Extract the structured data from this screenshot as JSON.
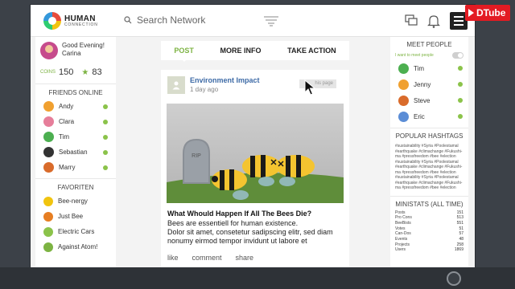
{
  "header": {
    "logo_line1": "HUMAN",
    "logo_line2": "CONNECTION",
    "search_placeholder": "Search Network"
  },
  "overlay": {
    "brand": "DTube"
  },
  "user": {
    "greeting": "Good Evening!",
    "name": "Carina",
    "coins_label": "COINS",
    "coins": "150",
    "stars": "83"
  },
  "friends": {
    "title": "FRIENDS ONLINE",
    "items": [
      {
        "name": "Andy",
        "color": "#f0a030"
      },
      {
        "name": "Clara",
        "color": "#e67e9a"
      },
      {
        "name": "Tim",
        "color": "#4caf50"
      },
      {
        "name": "Sebastian",
        "color": "#333333"
      },
      {
        "name": "Marry",
        "color": "#d96b2b"
      }
    ]
  },
  "favorites": {
    "title": "FAVORITEN",
    "items": [
      {
        "name": "Bee-nergy",
        "color": "#f1c40f"
      },
      {
        "name": "Just Bee",
        "color": "#e67e22"
      },
      {
        "name": "Electric Cars",
        "color": "#8bc34a"
      },
      {
        "name": "Against Atom!",
        "color": "#7cb342"
      }
    ]
  },
  "tabs": [
    {
      "label": "POST",
      "active": true
    },
    {
      "label": "MORE INFO",
      "active": false
    },
    {
      "label": "TAKE ACTION",
      "active": false
    }
  ],
  "post": {
    "author": "Environment Impact",
    "time": "1 day ago",
    "page_chip": "his page",
    "image_text": "RIP",
    "headline": "What Whould Happen If All The Bees Die?",
    "body_line1": "Bees are essentiell for human existence.",
    "body_line2": "Dolor sit amet, consetetur sadipscing elitr, sed diam",
    "body_line3": "nonumy eirmod tempor invidunt ut labore et",
    "actions": [
      "like",
      "comment",
      "share"
    ]
  },
  "meet_people": {
    "title": "MEET PEOPLE",
    "toggle_label": "I want to meet people",
    "items": [
      {
        "name": "Tim",
        "color": "#4caf50"
      },
      {
        "name": "Jenny",
        "color": "#f0a030"
      },
      {
        "name": "Steve",
        "color": "#d96b2b"
      },
      {
        "name": "Eric",
        "color": "#5b8dd6"
      }
    ]
  },
  "hashtags": {
    "title": "POPULAR HASHTAGS",
    "lines": [
      "#sustainability #Syria #Poolestamal",
      "#earthquake #climachange #Fukushi-",
      "ma #pressfreedom #bee #election",
      "#sustainability #Syria #Poolestamal",
      "#earthquake #climachange #Fukushi-",
      "ma #pressfreedom #bee #election",
      "#sustainability #Syria #Poolestamal",
      "#earthquake #climachange #Fukushi-",
      "ma #pressfreedom #bee #election"
    ]
  },
  "ministats": {
    "title": "MINISTATS (ALL TIME)",
    "rows": [
      {
        "label": "Posts",
        "value": "151"
      },
      {
        "label": "Pro Cons",
        "value": "513"
      },
      {
        "label": "BeeBists",
        "value": "551"
      },
      {
        "label": "Votes",
        "value": "51"
      },
      {
        "label": "Can-Dos",
        "value": "57"
      },
      {
        "label": "Events",
        "value": "48"
      },
      {
        "label": "Projects",
        "value": "258"
      },
      {
        "label": "Users",
        "value": "1869"
      }
    ]
  }
}
